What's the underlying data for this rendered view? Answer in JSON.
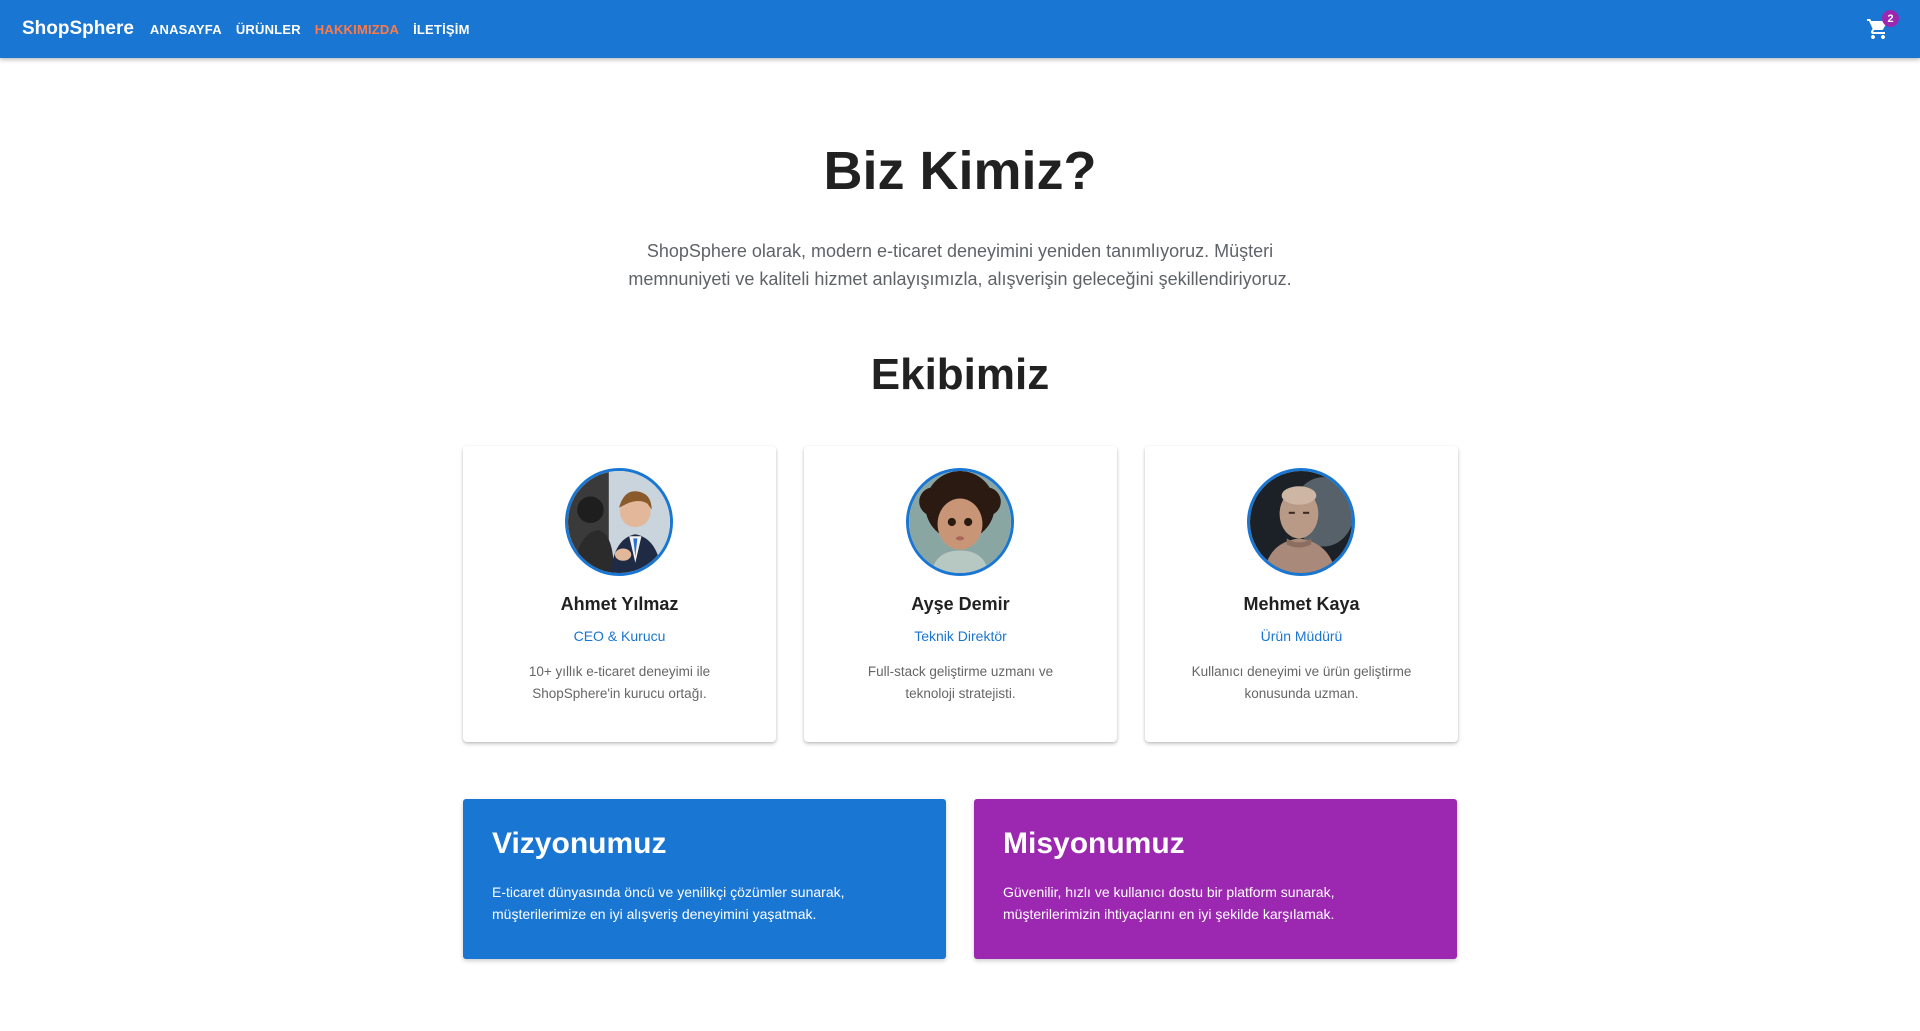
{
  "appbar": {
    "brand": "ShopSphere",
    "nav": [
      "ANASAYFA",
      "ÜRÜNLER",
      "HAKKIMIZDA",
      "İLETİŞİM"
    ],
    "active_nav": "HAKKIMIZDA",
    "cart_count": "2",
    "cart_icon": "shopping-cart-icon"
  },
  "hero": {
    "title": "Biz Kimiz?",
    "description": "ShopSphere olarak, modern e-ticaret deneyimini yeniden tanımlıyoruz. Müşteri memnuniyeti ve kaliteli hizmet anlayışımızla, alışverişin geleceğini şekillendiriyoruz."
  },
  "team": {
    "title": "Ekibimiz",
    "members": [
      {
        "name": "Ahmet Yılmaz",
        "role": "CEO & Kurucu",
        "bio": "10+ yıllık e-ticaret deneyimi ile ShopSphere'in kurucu ortağı."
      },
      {
        "name": "Ayşe Demir",
        "role": "Teknik Direktör",
        "bio": "Full-stack geliştirme uzmanı ve teknoloji stratejisti."
      },
      {
        "name": "Mehmet Kaya",
        "role": "Ürün Müdürü",
        "bio": "Kullanıcı deneyimi ve ürün geliştirme konusunda uzman."
      }
    ]
  },
  "vision": {
    "title": "Vizyonumuz",
    "text": "E-ticaret dünyasında öncü ve yenilikçi çözümler sunarak, müşterilerimize en iyi alışveriş deneyimini yaşatmak."
  },
  "mission": {
    "title": "Misyonumuz",
    "text": "Güvenilir, hızlı ve kullanıcı dostu bir platform sunarak, müşterilerimizin ihtiyaçlarını en iyi şekilde karşılamak."
  },
  "colors": {
    "primary": "#1976d2",
    "secondary": "#9c27b0",
    "active_nav": "#ff7a45"
  }
}
